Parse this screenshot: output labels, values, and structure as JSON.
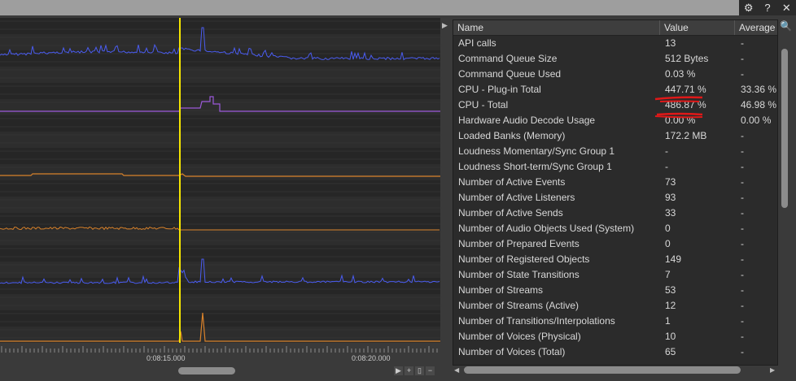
{
  "toolbar": {
    "icons": [
      "gear-icon",
      "help-icon",
      "close-icon"
    ],
    "settings_glyph": "⚙",
    "help_glyph": "?",
    "close_glyph": "✕"
  },
  "timeline": {
    "labels": [
      "0:08:15.000",
      "0:08:20.000"
    ]
  },
  "table": {
    "headers": {
      "name": "Name",
      "value": "Value",
      "average": "Average"
    },
    "rows": [
      {
        "name": "API calls",
        "value": "13",
        "average": "-"
      },
      {
        "name": "Command Queue Size",
        "value": "512 Bytes",
        "average": "-"
      },
      {
        "name": "Command Queue Used",
        "value": "0.03 %",
        "average": "-"
      },
      {
        "name": "CPU - Plug-in Total",
        "value": "447.71 %",
        "average": "33.36 %"
      },
      {
        "name": "CPU - Total",
        "value": "486.87 %",
        "average": "46.98 %"
      },
      {
        "name": "Hardware Audio Decode Usage",
        "value": "0.00 %",
        "average": "0.00 %"
      },
      {
        "name": "Loaded Banks (Memory)",
        "value": "172.2 MB",
        "average": "-"
      },
      {
        "name": "Loudness Momentary/Sync Group 1",
        "value": "-",
        "average": "-"
      },
      {
        "name": "Loudness Short-term/Sync Group 1",
        "value": "-",
        "average": "-"
      },
      {
        "name": "Number of Active Events",
        "value": "73",
        "average": "-"
      },
      {
        "name": "Number of Active Listeners",
        "value": "93",
        "average": "-"
      },
      {
        "name": "Number of Active Sends",
        "value": "33",
        "average": "-"
      },
      {
        "name": "Number of Audio Objects Used (System)",
        "value": "0",
        "average": "-"
      },
      {
        "name": "Number of Prepared Events",
        "value": "0",
        "average": "-"
      },
      {
        "name": "Number of Registered Objects",
        "value": "149",
        "average": "-"
      },
      {
        "name": "Number of State Transitions",
        "value": "7",
        "average": "-"
      },
      {
        "name": "Number of Streams",
        "value": "53",
        "average": "-"
      },
      {
        "name": "Number of Streams (Active)",
        "value": "12",
        "average": "-"
      },
      {
        "name": "Number of Transitions/Interpolations",
        "value": "1",
        "average": "-"
      },
      {
        "name": "Number of Voices (Physical)",
        "value": "10",
        "average": "-"
      },
      {
        "name": "Number of Voices (Total)",
        "value": "65",
        "average": "-"
      }
    ]
  },
  "colors": {
    "cursor": "#f5e600",
    "series_blue": "#4a5cf0",
    "series_purple": "#9b59d9",
    "series_orange": "#d9822b",
    "annotation_red": "#e01818"
  }
}
